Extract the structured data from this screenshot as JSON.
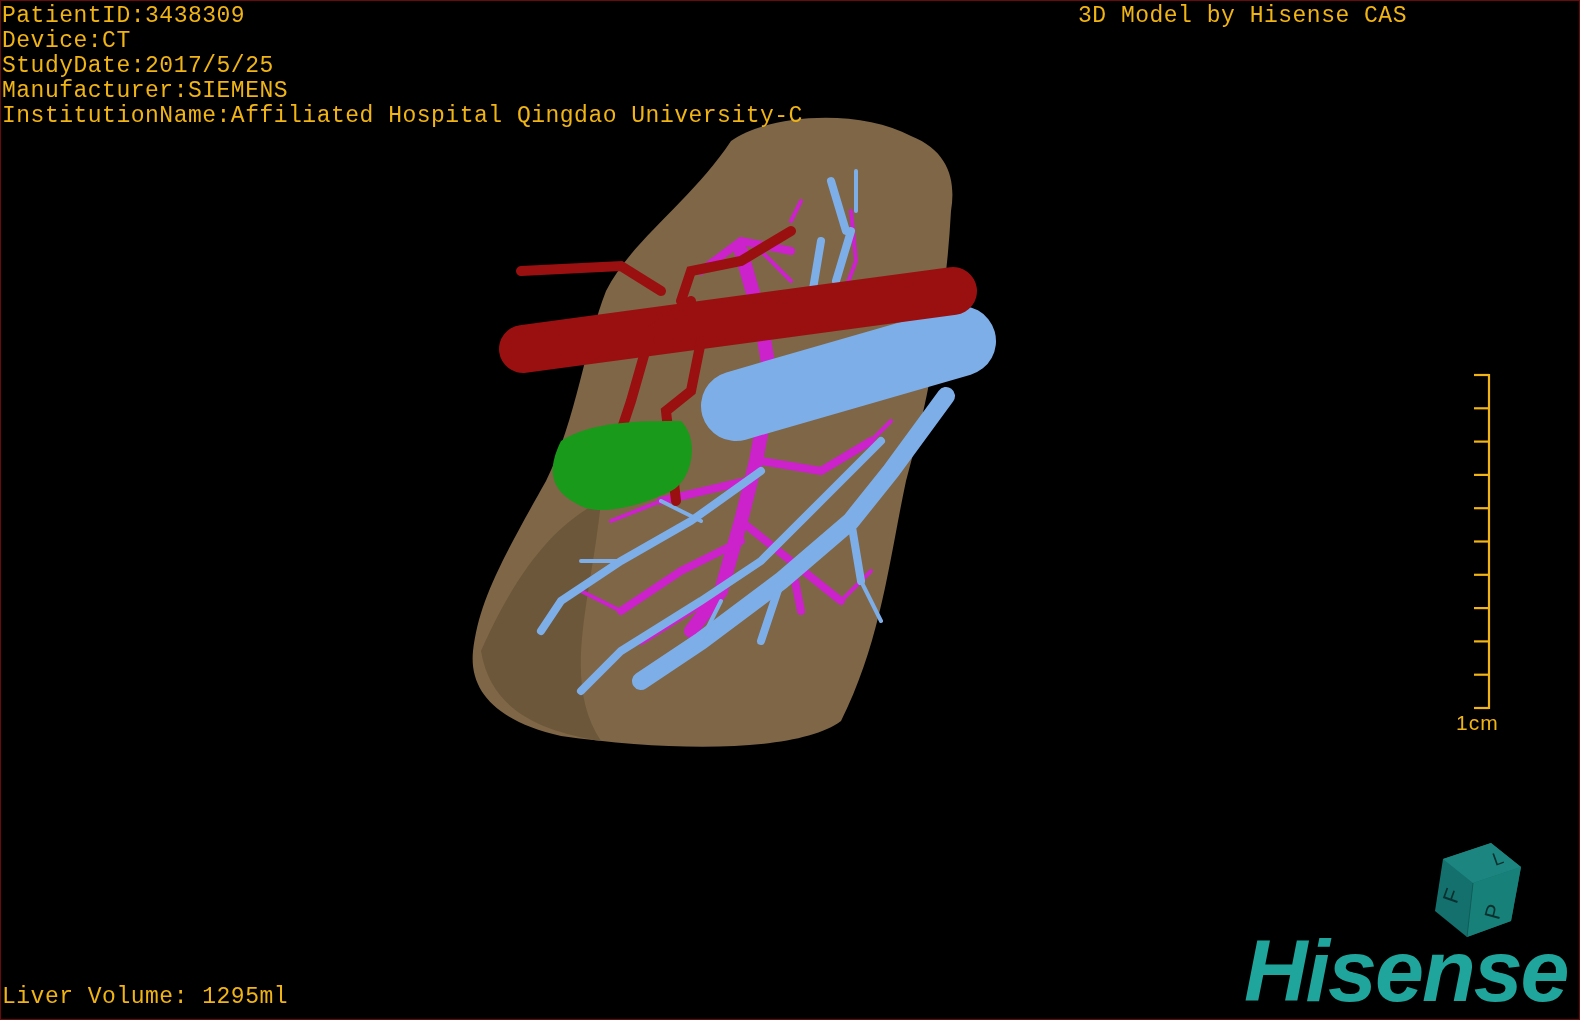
{
  "info_lines": [
    "PatientID:3438309",
    "Device:CT",
    "StudyDate:2017/5/25",
    "Manufacturer:SIEMENS",
    "InstitutionName:Affiliated Hospital Qingdao University-C"
  ],
  "title": "3D Model by Hisense CAS",
  "scale": {
    "label": "1cm"
  },
  "orientation_cube": {
    "faces": [
      "F",
      "L",
      "P"
    ]
  },
  "footer": {
    "volume": "Liver Volume: 1295ml"
  },
  "logo": "Hisense"
}
